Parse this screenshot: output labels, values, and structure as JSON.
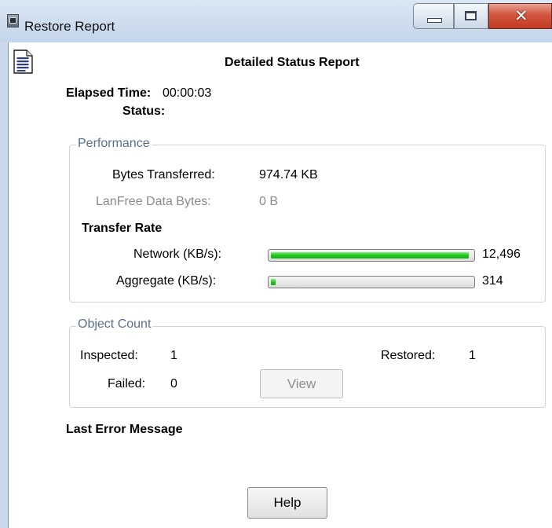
{
  "window": {
    "title": "Restore Report"
  },
  "header": {
    "title": "Detailed Status Report"
  },
  "summary": {
    "elapsed_label": "Elapsed Time:",
    "elapsed_value": "00:00:03",
    "status_label": "Status:",
    "status_value": ""
  },
  "performance": {
    "legend": "Performance",
    "bytes_label": "Bytes Transferred:",
    "bytes_value": "974.74 KB",
    "lanfree_label": "LanFree Data Bytes:",
    "lanfree_value": "0 B",
    "rate_heading": "Transfer Rate",
    "network_label": "Network (KB/s):",
    "network_value": "12,496",
    "network_fill_fraction": 0.985,
    "aggregate_label": "Aggregate (KB/s):",
    "aggregate_value": "314",
    "aggregate_fill_fraction": 0.025
  },
  "objects": {
    "legend": "Object Count",
    "inspected_label": "Inspected:",
    "inspected_value": "1",
    "restored_label": "Restored:",
    "restored_value": "1",
    "failed_label": "Failed:",
    "failed_value": "0",
    "view_label": "View"
  },
  "error": {
    "heading": "Last Error Message",
    "message": ""
  },
  "footer": {
    "help_label": "Help"
  },
  "icons": [
    "window-app-icon",
    "minimize-icon",
    "maximize-icon",
    "close-icon",
    "document-icon"
  ],
  "colors": {
    "progress_fill": "#1ec81e",
    "legend_text": "#56718f",
    "disabled_text": "#8a8a8a",
    "close_button": "#c8442c"
  }
}
